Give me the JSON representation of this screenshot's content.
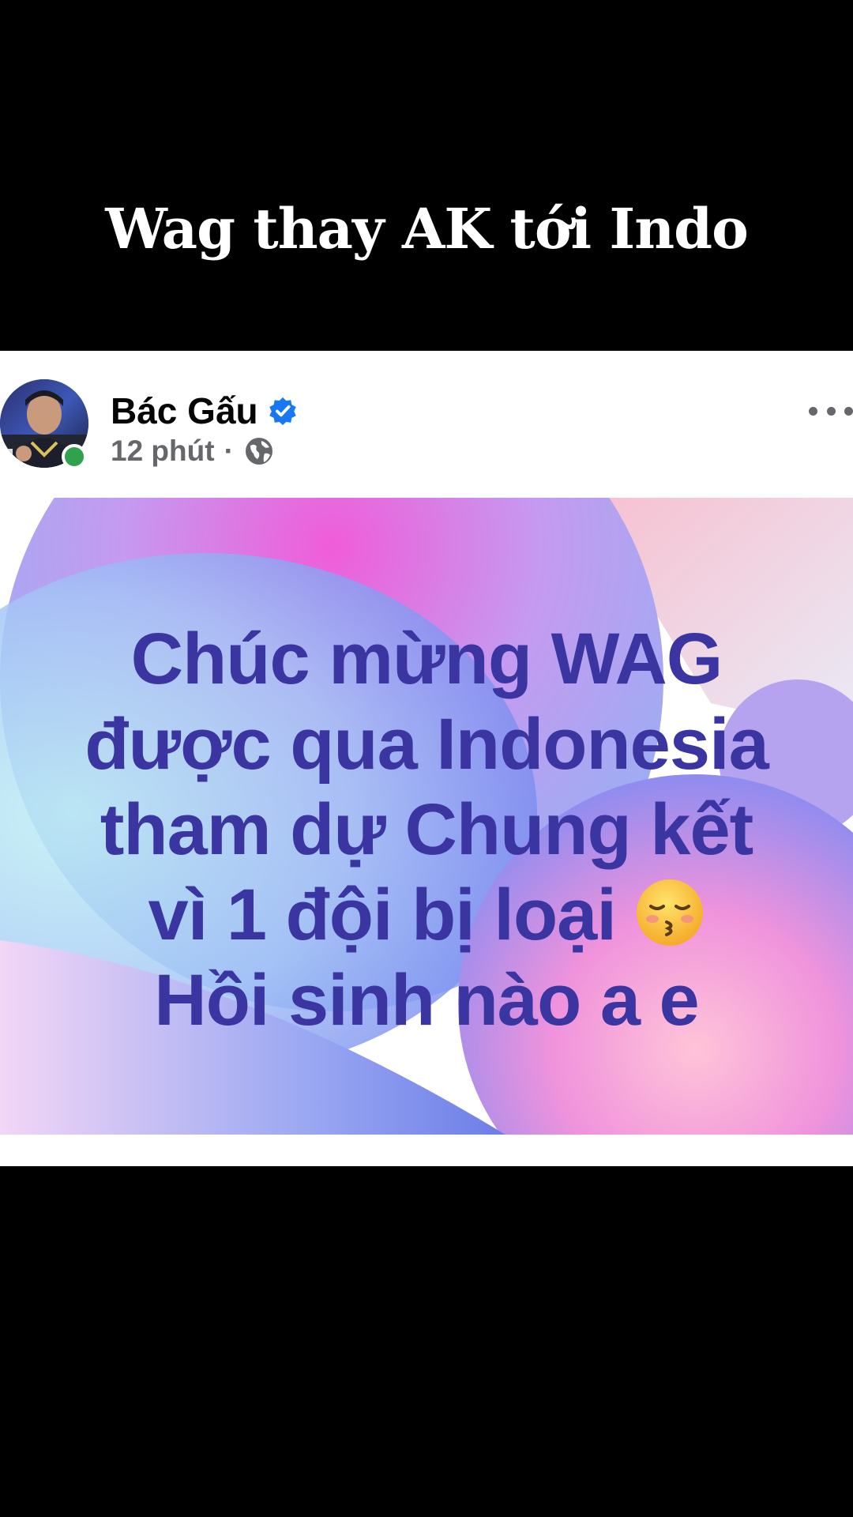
{
  "caption": "Wag thay AK tới Indo",
  "post": {
    "author": "Bác Gấu",
    "verified_icon": "verified-badge-icon",
    "time": "12 phút",
    "separator": "·",
    "privacy_icon": "globe-icon",
    "more_icon": "more-options-icon",
    "online": true,
    "text_lines": [
      "Chúc mừng WAG",
      "được qua Indonesia",
      "tham dự Chung kết",
      "vì 1 đội bị loại",
      "Hồi sinh nào a e"
    ],
    "emoji": "😚",
    "text_color": "#3a35a0"
  },
  "colors": {
    "background": "#000000",
    "card": "#ffffff",
    "verified": "#1877f2",
    "online": "#31a24c",
    "meta": "#65676b"
  }
}
